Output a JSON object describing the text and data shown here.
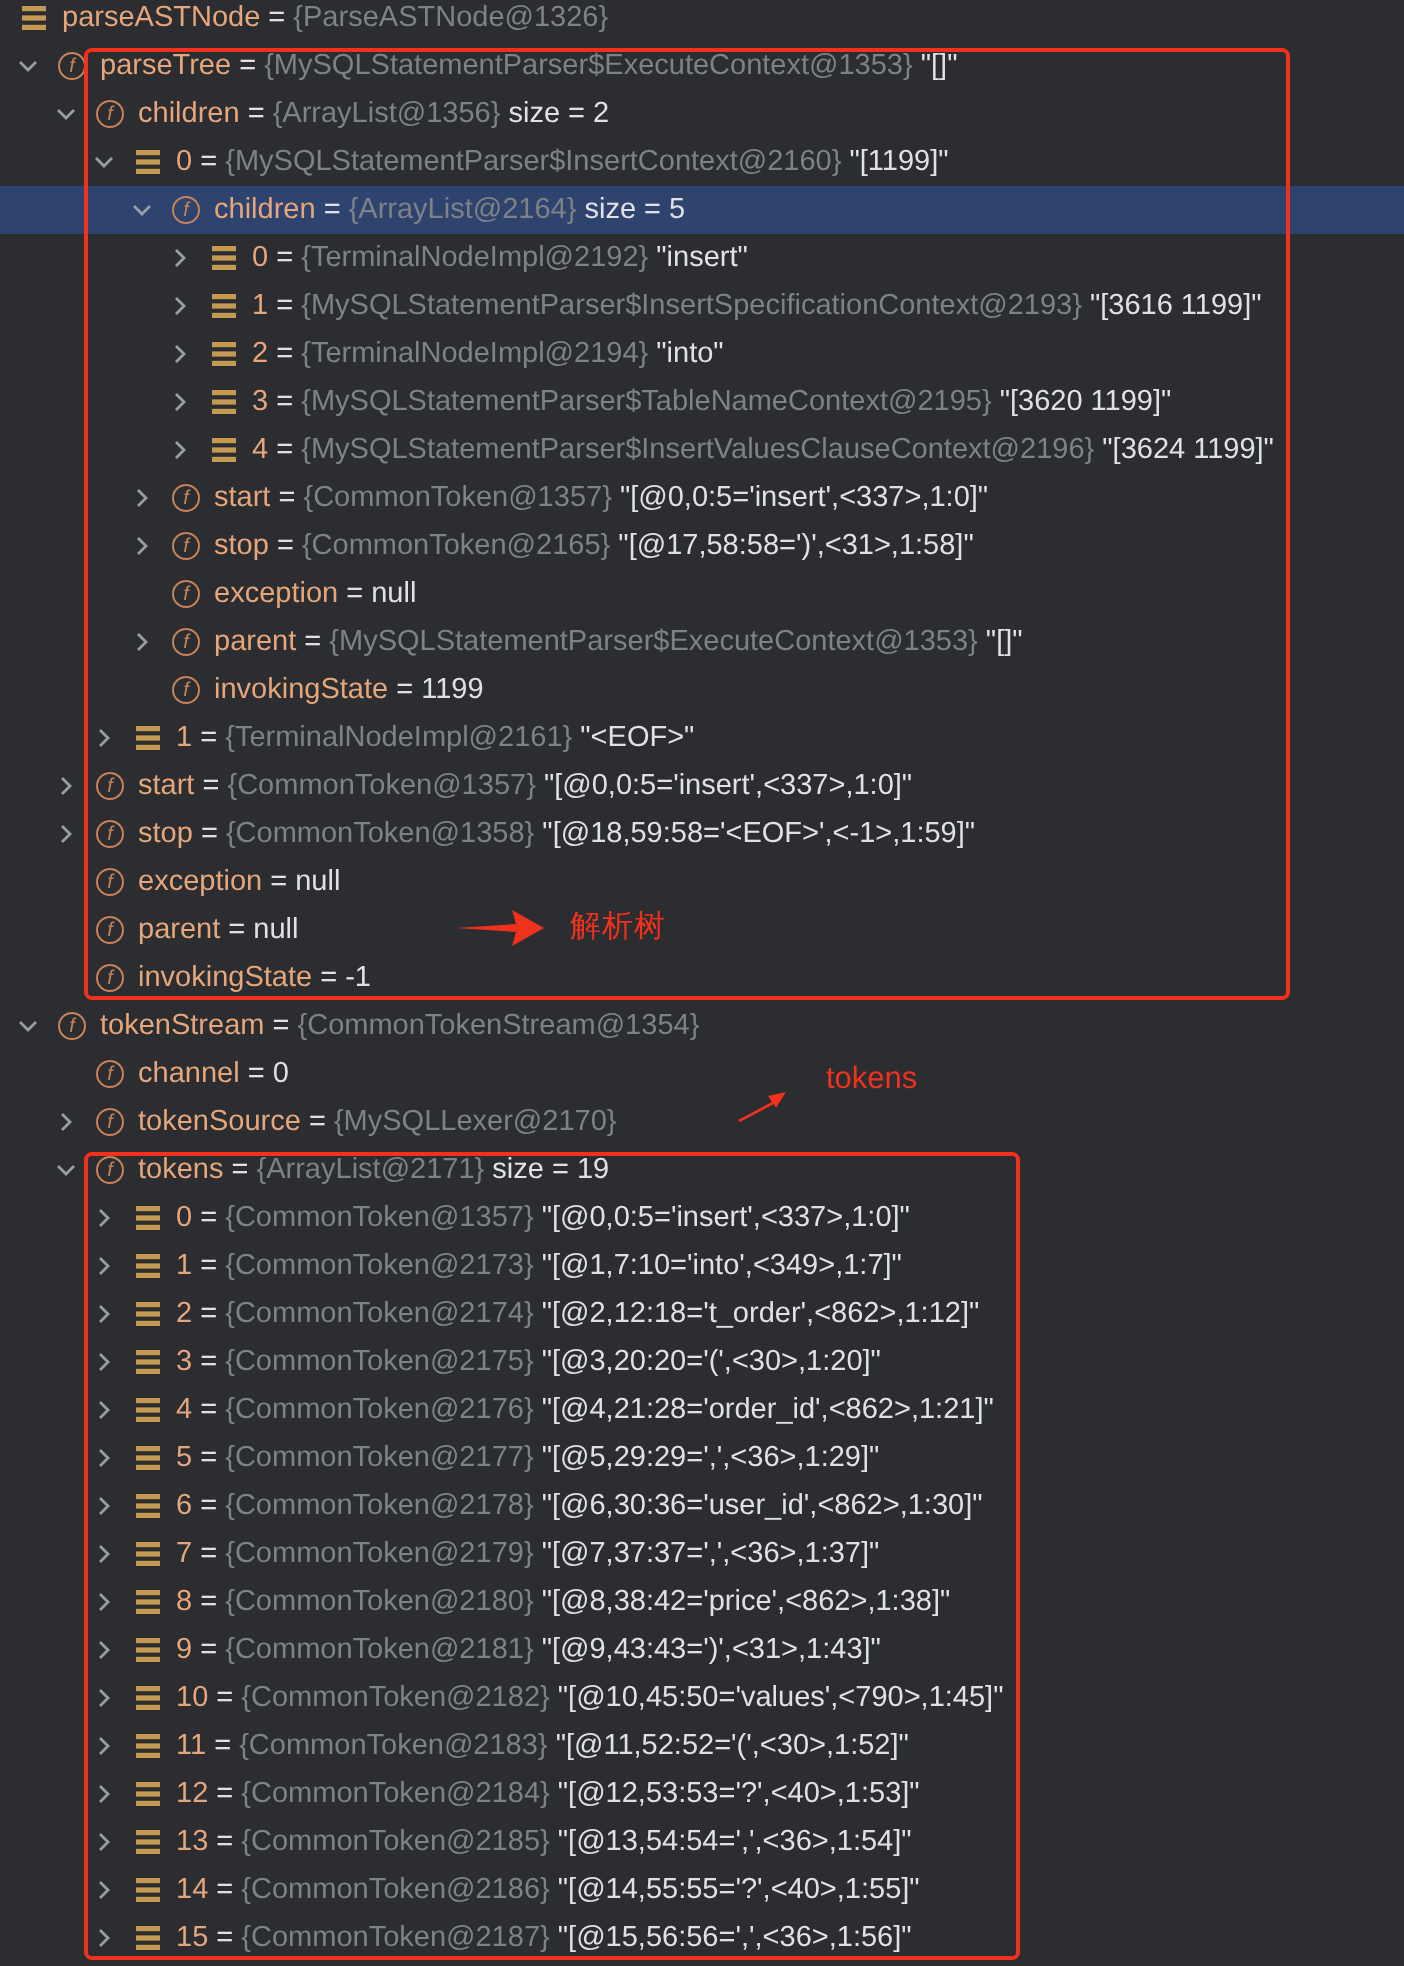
{
  "tree": [
    {
      "kind": "element",
      "name": "parseASTNode",
      "eq": "=",
      "type": "{ParseASTNode@1326}",
      "selected": false,
      "children": [
        {
          "kind": "field",
          "icon_letter": "f",
          "name": "parseTree",
          "eq": "=",
          "type": "{MySQLStatementParser$ExecuteContext@1353}",
          "value": "\"[]\"",
          "expanded": true,
          "selected": false,
          "boxed": true,
          "children": [
            {
              "kind": "field",
              "icon_letter": "f",
              "name": "children",
              "eq": "=",
              "type": "{ArrayList@1356}",
              "value": " size = 2",
              "expanded": true,
              "selected": false,
              "children": [
                {
                  "kind": "element",
                  "name": "0",
                  "eq": "=",
                  "type": "{MySQLStatementParser$InsertContext@2160}",
                  "value": "\"[1199]\"",
                  "expanded": true,
                  "selected": false,
                  "children": [
                    {
                      "kind": "field",
                      "icon_letter": "f",
                      "name": "children",
                      "eq": "=",
                      "type": "{ArrayList@2164}",
                      "value": " size = 5",
                      "expanded": true,
                      "selected": true,
                      "children": [
                        {
                          "kind": "element",
                          "name": "0",
                          "eq": "=",
                          "type": "{TerminalNodeImpl@2192}",
                          "value": "\"insert\"",
                          "expanded": false,
                          "selected": false
                        },
                        {
                          "kind": "element",
                          "name": "1",
                          "eq": "=",
                          "type": "{MySQLStatementParser$InsertSpecificationContext@2193}",
                          "value": "\"[3616 1199]\"",
                          "expanded": false,
                          "selected": false
                        },
                        {
                          "kind": "element",
                          "name": "2",
                          "eq": "=",
                          "type": "{TerminalNodeImpl@2194}",
                          "value": "\"into\"",
                          "expanded": false,
                          "selected": false
                        },
                        {
                          "kind": "element",
                          "name": "3",
                          "eq": "=",
                          "type": "{MySQLStatementParser$TableNameContext@2195}",
                          "value": "\"[3620 1199]\"",
                          "expanded": false,
                          "selected": false
                        },
                        {
                          "kind": "element",
                          "name": "4",
                          "eq": "=",
                          "type": "{MySQLStatementParser$InsertValuesClauseContext@2196}",
                          "value": "\"[3624 1199]\"",
                          "expanded": false,
                          "selected": false
                        }
                      ]
                    },
                    {
                      "kind": "field",
                      "icon_letter": "f",
                      "name": "start",
                      "eq": "=",
                      "type": "{CommonToken@1357}",
                      "value": "\"[@0,0:5='insert',<337>,1:0]\"",
                      "expanded": false,
                      "selected": false
                    },
                    {
                      "kind": "field",
                      "icon_letter": "f",
                      "name": "stop",
                      "eq": "=",
                      "type": "{CommonToken@2165}",
                      "value": "\"[@17,58:58=')',<31>,1:58]\"",
                      "expanded": false,
                      "selected": false
                    },
                    {
                      "kind": "field",
                      "icon_letter": "f",
                      "name": "exception",
                      "eq": "=",
                      "value": "null",
                      "selected": false
                    },
                    {
                      "kind": "field",
                      "icon_letter": "f",
                      "name": "parent",
                      "eq": "=",
                      "type": "{MySQLStatementParser$ExecuteContext@1353}",
                      "value": "\"[]\"",
                      "expanded": false,
                      "selected": false
                    },
                    {
                      "kind": "field",
                      "icon_letter": "f",
                      "name": "invokingState",
                      "eq": "=",
                      "value": "1199",
                      "selected": false
                    }
                  ]
                },
                {
                  "kind": "element",
                  "name": "1",
                  "eq": "=",
                  "type": "{TerminalNodeImpl@2161}",
                  "value": "\"<EOF>\"",
                  "expanded": false,
                  "selected": false
                }
              ]
            },
            {
              "kind": "field",
              "icon_letter": "f",
              "name": "start",
              "eq": "=",
              "type": "{CommonToken@1357}",
              "value": "\"[@0,0:5='insert',<337>,1:0]\"",
              "expanded": false,
              "selected": false
            },
            {
              "kind": "field",
              "icon_letter": "f",
              "name": "stop",
              "eq": "=",
              "type": "{CommonToken@1358}",
              "value": "\"[@18,59:58='<EOF>',<-1>,1:59]\"",
              "expanded": false,
              "selected": false
            },
            {
              "kind": "field",
              "icon_letter": "f",
              "name": "exception",
              "eq": "=",
              "value": "null",
              "selected": false
            },
            {
              "kind": "field",
              "icon_letter": "f",
              "name": "parent",
              "eq": "=",
              "value": "null",
              "selected": false
            },
            {
              "kind": "field",
              "icon_letter": "f",
              "name": "invokingState",
              "eq": "=",
              "value": "-1",
              "selected": false
            }
          ]
        },
        {
          "kind": "field",
          "icon_letter": "f",
          "name": "tokenStream",
          "eq": "=",
          "type": "{CommonTokenStream@1354}",
          "expanded": true,
          "selected": false,
          "children": [
            {
              "kind": "field",
              "icon_letter": "f",
              "name": "channel",
              "eq": "=",
              "value": "0",
              "selected": false
            },
            {
              "kind": "field",
              "icon_letter": "f",
              "name": "tokenSource",
              "eq": "=",
              "type": "{MySQLLexer@2170}",
              "expanded": false,
              "selected": false
            },
            {
              "kind": "field",
              "icon_letter": "f",
              "name": "tokens",
              "eq": "=",
              "type": "{ArrayList@2171}",
              "value": " size = 19",
              "expanded": true,
              "selected": false,
              "boxed": true,
              "children": [
                {
                  "kind": "element",
                  "name": "0",
                  "eq": "=",
                  "type": "{CommonToken@1357}",
                  "value": "\"[@0,0:5='insert',<337>,1:0]\"",
                  "expanded": false,
                  "selected": false
                },
                {
                  "kind": "element",
                  "name": "1",
                  "eq": "=",
                  "type": "{CommonToken@2173}",
                  "value": "\"[@1,7:10='into',<349>,1:7]\"",
                  "expanded": false,
                  "selected": false
                },
                {
                  "kind": "element",
                  "name": "2",
                  "eq": "=",
                  "type": "{CommonToken@2174}",
                  "value": "\"[@2,12:18='t_order',<862>,1:12]\"",
                  "expanded": false,
                  "selected": false
                },
                {
                  "kind": "element",
                  "name": "3",
                  "eq": "=",
                  "type": "{CommonToken@2175}",
                  "value": "\"[@3,20:20='(',<30>,1:20]\"",
                  "expanded": false,
                  "selected": false
                },
                {
                  "kind": "element",
                  "name": "4",
                  "eq": "=",
                  "type": "{CommonToken@2176}",
                  "value": "\"[@4,21:28='order_id',<862>,1:21]\"",
                  "expanded": false,
                  "selected": false
                },
                {
                  "kind": "element",
                  "name": "5",
                  "eq": "=",
                  "type": "{CommonToken@2177}",
                  "value": "\"[@5,29:29=',',<36>,1:29]\"",
                  "expanded": false,
                  "selected": false
                },
                {
                  "kind": "element",
                  "name": "6",
                  "eq": "=",
                  "type": "{CommonToken@2178}",
                  "value": "\"[@6,30:36='user_id',<862>,1:30]\"",
                  "expanded": false,
                  "selected": false
                },
                {
                  "kind": "element",
                  "name": "7",
                  "eq": "=",
                  "type": "{CommonToken@2179}",
                  "value": "\"[@7,37:37=',',<36>,1:37]\"",
                  "expanded": false,
                  "selected": false
                },
                {
                  "kind": "element",
                  "name": "8",
                  "eq": "=",
                  "type": "{CommonToken@2180}",
                  "value": "\"[@8,38:42='price',<862>,1:38]\"",
                  "expanded": false,
                  "selected": false
                },
                {
                  "kind": "element",
                  "name": "9",
                  "eq": "=",
                  "type": "{CommonToken@2181}",
                  "value": "\"[@9,43:43=')',<31>,1:43]\"",
                  "expanded": false,
                  "selected": false
                },
                {
                  "kind": "element",
                  "name": "10",
                  "eq": "=",
                  "type": "{CommonToken@2182}",
                  "value": "\"[@10,45:50='values',<790>,1:45]\"",
                  "expanded": false,
                  "selected": false
                },
                {
                  "kind": "element",
                  "name": "11",
                  "eq": "=",
                  "type": "{CommonToken@2183}",
                  "value": "\"[@11,52:52='(',<30>,1:52]\"",
                  "expanded": false,
                  "selected": false
                },
                {
                  "kind": "element",
                  "name": "12",
                  "eq": "=",
                  "type": "{CommonToken@2184}",
                  "value": "\"[@12,53:53='?',<40>,1:53]\"",
                  "expanded": false,
                  "selected": false
                },
                {
                  "kind": "element",
                  "name": "13",
                  "eq": "=",
                  "type": "{CommonToken@2185}",
                  "value": "\"[@13,54:54=',',<36>,1:54]\"",
                  "expanded": false,
                  "selected": false
                },
                {
                  "kind": "element",
                  "name": "14",
                  "eq": "=",
                  "type": "{CommonToken@2186}",
                  "value": "\"[@14,55:55='?',<40>,1:55]\"",
                  "expanded": false,
                  "selected": false
                },
                {
                  "kind": "element",
                  "name": "15",
                  "eq": "=",
                  "type": "{CommonToken@2187}",
                  "value": "\"[@15,56:56=',',<36>,1:56]\"",
                  "expanded": false,
                  "selected": false
                }
              ]
            }
          ]
        }
      ]
    }
  ],
  "annotations": [
    {
      "kind": "arrow-right",
      "text": "解析树"
    },
    {
      "kind": "arrow-up-right",
      "text": "tokens"
    }
  ]
}
